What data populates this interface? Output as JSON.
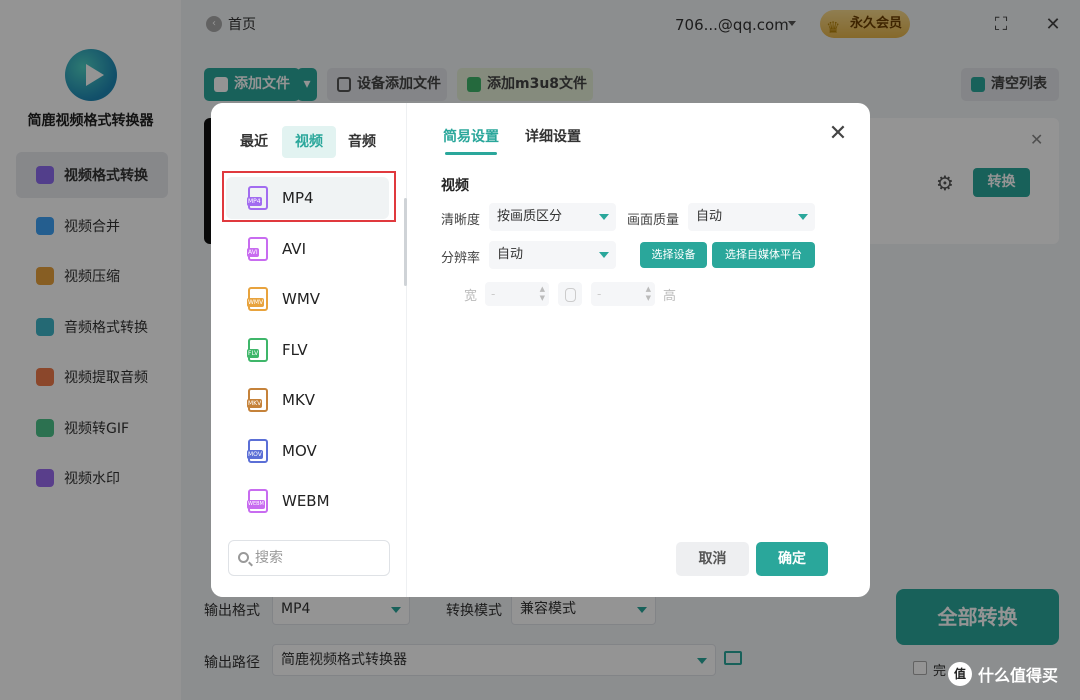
{
  "app": {
    "name": "简鹿视频格式转换器",
    "home_label": "首页",
    "account": "706...@qq.com",
    "vip_label": "永久会员"
  },
  "sidebar": {
    "items": [
      {
        "label": "视频格式转换",
        "icon": "video-convert-icon",
        "color": "#8e6cf0"
      },
      {
        "label": "视频合并",
        "icon": "video-merge-icon",
        "color": "#3fa2f7"
      },
      {
        "label": "视频压缩",
        "icon": "video-compress-icon",
        "color": "#e8a33d"
      },
      {
        "label": "音频格式转换",
        "icon": "audio-convert-icon",
        "color": "#3fb6c9"
      },
      {
        "label": "视频提取音频",
        "icon": "extract-audio-icon",
        "color": "#f07a4a"
      },
      {
        "label": "视频转GIF",
        "icon": "gif-icon",
        "color": "#4cc38a"
      },
      {
        "label": "视频水印",
        "icon": "watermark-icon",
        "color": "#9a6cf0"
      }
    ]
  },
  "toolbar": {
    "add_file": "添加文件",
    "add_device_file": "设备添加文件",
    "add_m3u8": "添加m3u8文件",
    "clear_list": "清空列表"
  },
  "file_card": {
    "convert_label": "转换"
  },
  "bottom": {
    "output_format_label": "输出格式",
    "output_format_value": "MP4",
    "convert_mode_label": "转换模式",
    "convert_mode_value": "兼容模式",
    "output_path_label": "输出路径",
    "output_path_value": "简鹿视频格式转换器",
    "convert_all": "全部转换",
    "after_done_text": "完"
  },
  "dialog": {
    "left_tabs": [
      "最近",
      "视频",
      "音频"
    ],
    "active_left_tab": "视频",
    "formats": [
      {
        "name": "MP4",
        "color": "#a26cf0"
      },
      {
        "name": "AVI",
        "color": "#c86cf0"
      },
      {
        "name": "WMV",
        "color": "#e8a33d"
      },
      {
        "name": "FLV",
        "color": "#3fb66a"
      },
      {
        "name": "MKV",
        "color": "#c5823a"
      },
      {
        "name": "MOV",
        "color": "#5b6fd6"
      },
      {
        "name": "WEBM",
        "color": "#c86cf0"
      }
    ],
    "selected_format": "MP4",
    "search_placeholder": "搜索",
    "right_tabs": [
      "简易设置",
      "详细设置"
    ],
    "active_right_tab": "简易设置",
    "section_title": "视频",
    "clarity_label": "清晰度",
    "clarity_value": "按画质区分",
    "quality_label": "画面质量",
    "quality_value": "自动",
    "resolution_label": "分辨率",
    "resolution_value": "自动",
    "select_device": "选择设备",
    "select_platform": "选择自媒体平台",
    "width_label": "宽",
    "height_label": "高",
    "width_value": "-",
    "height_value": "-",
    "cancel": "取消",
    "confirm": "确定"
  },
  "watermark": {
    "text": "什么值得买",
    "badge": "值"
  },
  "colors": {
    "accent": "#2aa79b",
    "highlight": "#e0393e"
  }
}
